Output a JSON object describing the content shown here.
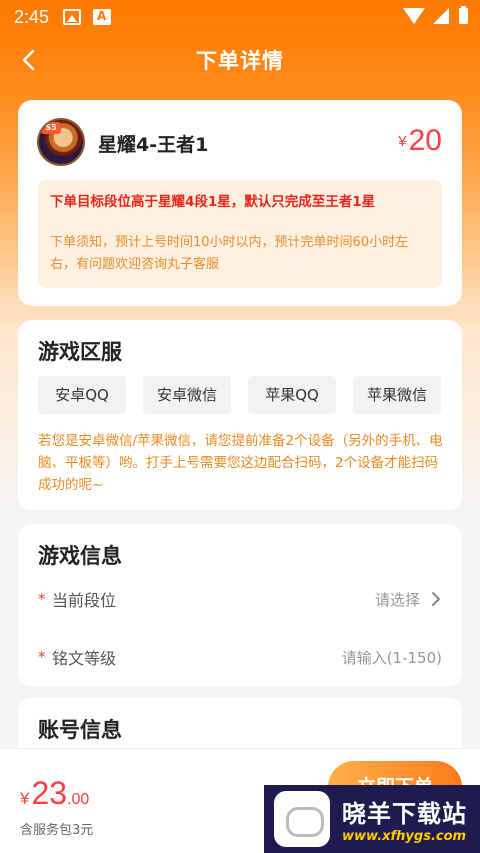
{
  "status_bar": {
    "time": "2:45"
  },
  "nav": {
    "title": "下单详情"
  },
  "order": {
    "rank": "星耀4-王者1",
    "currency": "¥",
    "price": "20",
    "avatar_badge": "S5",
    "notice_main": "下单目标段位高于星耀4段1星，默认只完成至王者1星",
    "notice_sub": "下单须知，预计上号时间10小时以内，预计完单时间60小时左右，有问题欢迎咨询丸子客服"
  },
  "server": {
    "title": "游戏区服",
    "options": [
      "安卓QQ",
      "安卓微信",
      "苹果QQ",
      "苹果微信"
    ],
    "tip": "若您是安卓微信/苹果微信，请您提前准备2个设备（另外的手机、电脑、平板等）哟。打手上号需要您这边配合扫码，2个设备才能扫码成功的呢~"
  },
  "game_info": {
    "title": "游戏信息",
    "required_mark": "*",
    "fields": [
      {
        "label": "当前段位",
        "value": "请选择"
      },
      {
        "label": "铭文等级",
        "value": "请输入(1-150)"
      }
    ]
  },
  "account_info": {
    "title": "账号信息"
  },
  "bottom": {
    "currency": "¥",
    "total_int": "23",
    "total_dec": ".00",
    "service_note": "含服务包3元",
    "order_button": "立即下单"
  },
  "watermark": {
    "title": "晓羊下载站",
    "url": "www.xfhygs.com"
  },
  "colors": {
    "primary": "#ff7a00",
    "price": "#ff4040",
    "tip": "#ee8a1f",
    "warning": "#e8261b"
  }
}
